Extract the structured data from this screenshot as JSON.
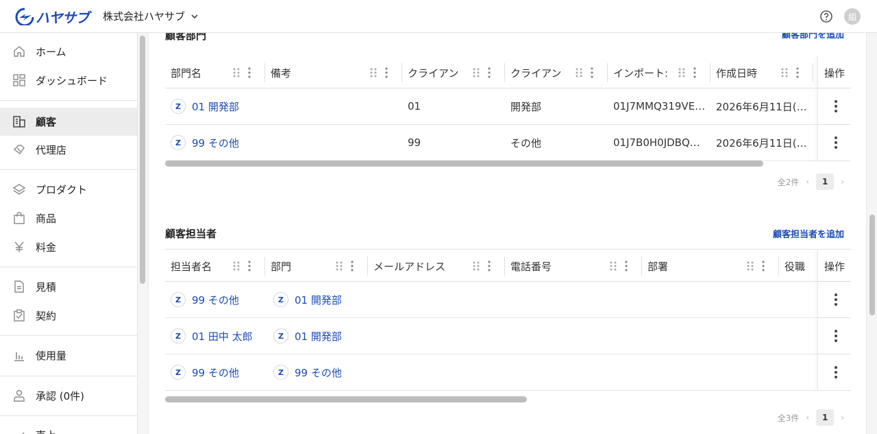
{
  "header": {
    "logo_text": "ハヤサブ",
    "company": "株式会社ハヤサブ",
    "avatar": "組"
  },
  "sidebar": {
    "items": [
      {
        "label": "ホーム",
        "icon": "home-icon"
      },
      {
        "label": "ダッシュボード",
        "icon": "dashboard-icon"
      },
      {
        "label": "顧客",
        "icon": "customer-icon",
        "active": true
      },
      {
        "label": "代理店",
        "icon": "agency-icon"
      },
      {
        "label": "プロダクト",
        "icon": "layers-icon"
      },
      {
        "label": "商品",
        "icon": "bag-icon"
      },
      {
        "label": "料金",
        "icon": "yen-icon"
      },
      {
        "label": "見積",
        "icon": "document-icon"
      },
      {
        "label": "契約",
        "icon": "clipboard-check-icon"
      },
      {
        "label": "使用量",
        "icon": "bar-chart-icon"
      },
      {
        "label": "承認 (0件)",
        "icon": "person-icon"
      },
      {
        "label": "売上",
        "icon": "trend-icon"
      }
    ]
  },
  "departments": {
    "title": "顧客部門",
    "add_label": "顧客部門を追加",
    "columns": [
      "部門名",
      "備考",
      "クライアン",
      "クライアン",
      "インポート:",
      "作成日時"
    ],
    "ops_label": "操作",
    "rows": [
      {
        "badge": "Z",
        "name": "01 開発部",
        "note": "",
        "client_code": "01",
        "client_name": "開発部",
        "import_id": "01J7MMQ319VE…",
        "created": "2026年6月11日(…"
      },
      {
        "badge": "Z",
        "name": "99 その他",
        "note": "",
        "client_code": "99",
        "client_name": "その他",
        "import_id": "01J7B0H0JDBQ…",
        "created": "2026年6月11日(…"
      }
    ],
    "total": "全2件",
    "page": "1"
  },
  "contacts": {
    "title": "顧客担当者",
    "add_label": "顧客担当者を追加",
    "columns": [
      "担当者名",
      "部門",
      "メールアドレス",
      "電話番号",
      "部署",
      "役職"
    ],
    "ops_label": "操作",
    "rows": [
      {
        "badge": "Z",
        "name": "99 その他",
        "dept_badge": "Z",
        "dept": "01 開発部"
      },
      {
        "badge": "Z",
        "name": "01 田中 太郎",
        "dept_badge": "Z",
        "dept": "01 開発部"
      },
      {
        "badge": "Z",
        "name": "99 その他",
        "dept_badge": "Z",
        "dept": "99 その他"
      }
    ],
    "total": "全3件",
    "page": "1"
  }
}
